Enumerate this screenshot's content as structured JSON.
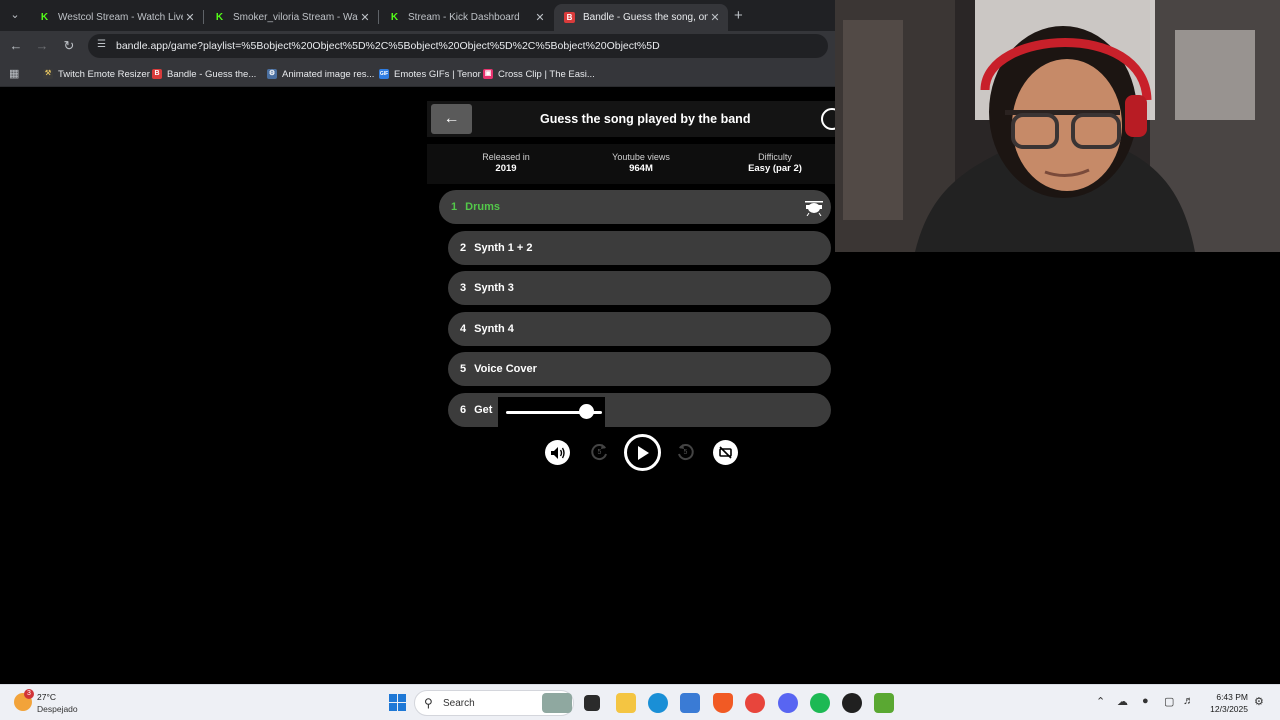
{
  "browser": {
    "tabs": [
      {
        "title": "Westcol Stream - Watch Live on Kick",
        "favicon": "kick"
      },
      {
        "title": "Smoker_viloria Stream - Watch Live on Kick",
        "favicon": "kick"
      },
      {
        "title": "Stream - Kick Dashboard",
        "favicon": "kick"
      },
      {
        "title": "Bandle - Guess the song, one instrument at a time",
        "favicon": "bandle",
        "active": true
      }
    ],
    "url": "bandle.app/game?playlist=%5Bobject%20Object%5D%2C%5Bobject%20Object%5D%2C%5Bobject%20Object%5D",
    "bookmarks": [
      {
        "label": "Twitch Emote Resizer",
        "icon": "wrench-icon"
      },
      {
        "label": "Bandle - Guess the...",
        "icon": "bandle-icon"
      },
      {
        "label": "Animated image res...",
        "icon": "gear-icon"
      },
      {
        "label": "Emotes GIFs | Tenor",
        "icon": "gif-icon"
      },
      {
        "label": "Cross Clip | The Easi...",
        "icon": "crossclip-icon"
      }
    ]
  },
  "game": {
    "title": "Guess the song played by the band",
    "info": [
      {
        "label": "Released in",
        "value": "2019"
      },
      {
        "label": "Youtube views",
        "value": "964M"
      },
      {
        "label": "Difficulty",
        "value": "Easy (par 2)"
      }
    ],
    "tracks": [
      {
        "num": "1",
        "name": "Drums",
        "active": true
      },
      {
        "num": "2",
        "name": "Synth 1 + 2"
      },
      {
        "num": "3",
        "name": "Synth 3"
      },
      {
        "num": "4",
        "name": "Synth 4"
      },
      {
        "num": "5",
        "name": "Voice Cover"
      },
      {
        "num": "6",
        "name": "Get"
      }
    ],
    "volume_level": 0.83,
    "rewind_label": "5",
    "forward_label": "5",
    "accent_color": "#53c84a"
  },
  "taskbar": {
    "weather_temp": "27°C",
    "weather_desc": "Despejado",
    "weather_badge": "3",
    "search_placeholder": "Search",
    "time": "6:43 PM",
    "date": "12/3/2025"
  }
}
